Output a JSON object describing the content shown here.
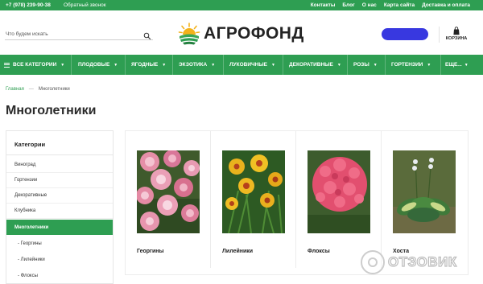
{
  "colors": {
    "brand_green": "#2e9e52",
    "text_dark": "#222222"
  },
  "topbar": {
    "phone": "+7 (978) 239-90-38",
    "callback": "Обратный звонок",
    "links": [
      "Контакты",
      "Блог",
      "О нас",
      "Карта сайта",
      "Доставка и оплата"
    ]
  },
  "search": {
    "placeholder": "Что будем искать",
    "icon": "search-icon"
  },
  "logo": {
    "name": "АГРОФОНД",
    "icon": "sun-field-logo"
  },
  "cart": {
    "label": "КОРЗИНА",
    "icon": "shopping-bag-icon"
  },
  "nav": {
    "items": [
      {
        "label": "ВСЕ КАТЕГОРИИ",
        "has_menu_icon": true
      },
      {
        "label": "ПЛОДОВЫЕ"
      },
      {
        "label": "ЯГОДНЫЕ"
      },
      {
        "label": "ЭКЗОТИКА"
      },
      {
        "label": "ЛУКОВИЧНЫЕ"
      },
      {
        "label": "ДЕКОРАТИВНЫЕ"
      },
      {
        "label": "РОЗЫ"
      },
      {
        "label": "ГОРТЕНЗИИ"
      },
      {
        "label": "ЕЩЕ..."
      }
    ],
    "chevron": "▼"
  },
  "breadcrumb": {
    "home": "Главная",
    "separator": "—",
    "current": "Многолетники"
  },
  "page_title": "Многолетники",
  "sidebar": {
    "title": "Категории",
    "items": [
      {
        "label": "Виноград"
      },
      {
        "label": "Гортензии"
      },
      {
        "label": "Декоративные"
      },
      {
        "label": "Клубника"
      },
      {
        "label": "Многолетники",
        "active": true
      },
      {
        "label": "- Георгины",
        "sub": true
      },
      {
        "label": "- Лилейники",
        "sub": true
      },
      {
        "label": "- Флоксы",
        "sub": true
      }
    ]
  },
  "products": [
    {
      "name": "Георгины"
    },
    {
      "name": "Лилейники"
    },
    {
      "name": "Флоксы"
    },
    {
      "name": "Хоста"
    }
  ],
  "watermark": {
    "text": "ОТЗОВИК"
  }
}
